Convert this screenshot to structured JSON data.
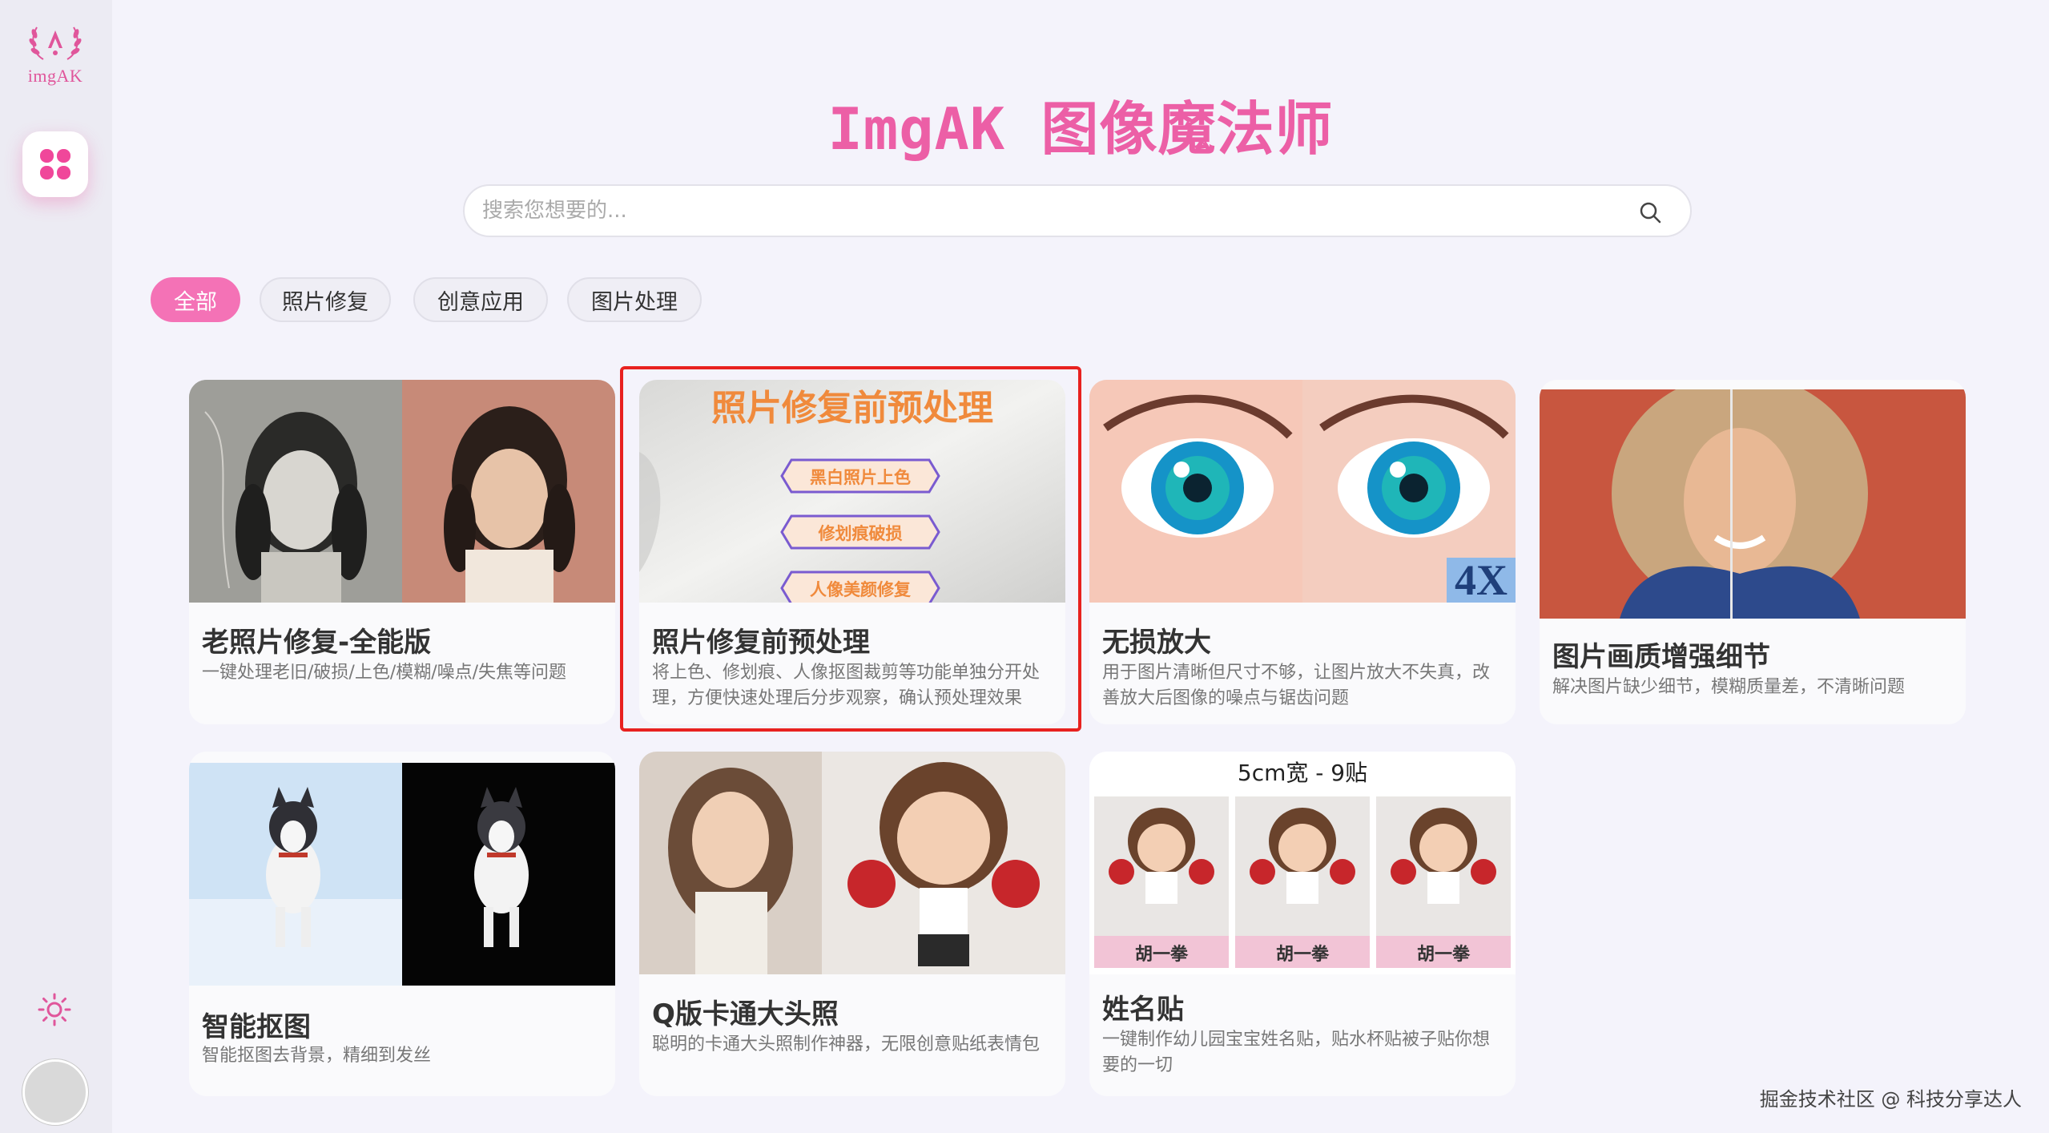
{
  "brand": {
    "name": "imgAK"
  },
  "header": {
    "title": "ImgAK 图像魔法师"
  },
  "search": {
    "placeholder": "搜索您想要的..."
  },
  "tabs": [
    {
      "label": "全部",
      "active": true
    },
    {
      "label": "照片修复",
      "active": false
    },
    {
      "label": "创意应用",
      "active": false
    },
    {
      "label": "图片处理",
      "active": false
    }
  ],
  "cards": [
    {
      "title": "老照片修复-全能版",
      "desc": "一键处理老旧/破损/上色/模糊/噪点/失焦等问题"
    },
    {
      "title": "照片修复前预处理",
      "desc": "将上色、修划痕、人像抠图裁剪等功能单独分开处理，方便快速处理后分步观察，确认预处理效果",
      "image_text": {
        "heading": "照片修复前预处理",
        "chips": [
          "黑白照片上色",
          "修划痕破损",
          "人像美颜修复"
        ]
      }
    },
    {
      "title": "无损放大",
      "desc": "用于图片清晰但尺寸不够，让图片放大不失真，改善放大后图像的噪点与锯齿问题",
      "image_text": {
        "badge": "4X"
      }
    },
    {
      "title": "图片画质增强细节",
      "desc": "解决图片缺少细节，模糊质量差，不清晰问题"
    },
    {
      "title": "智能抠图",
      "desc": "智能抠图去背景，精细到发丝"
    },
    {
      "title": "Q版卡通大头照",
      "desc": "聪明的卡通大头照制作神器，无限创意贴纸表情包"
    },
    {
      "title": "姓名贴",
      "desc": "一键制作幼儿园宝宝姓名贴，贴水杯贴被子贴你想要的一切",
      "image_text": {
        "heading": "5cm宽 - 9贴",
        "label": "胡一拳"
      }
    }
  ],
  "watermark": "掘金技术社区 @ 科技分享达人",
  "colors": {
    "accent": "#ec5fa6",
    "highlight": "#e8211f",
    "background": "#f4f3fb"
  }
}
